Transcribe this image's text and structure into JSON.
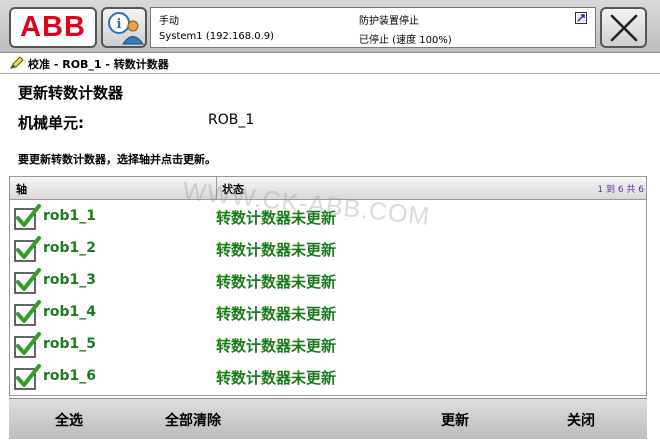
{
  "header": {
    "logo_text": "ABB",
    "mode": "手动",
    "system": "System1 (192.168.0.9)",
    "safety": "防护装置停止",
    "state": "已停止 (速度 100%)"
  },
  "title": {
    "text": "校准 - ROB_1 - 转数计数器"
  },
  "content": {
    "heading": "更新转数计数器",
    "mech_unit_label": "机械单元:",
    "mech_unit_value": "ROB_1",
    "instruction": "要更新转数计数器，选择轴并点击更新。"
  },
  "table": {
    "col_axis": "轴",
    "col_status": "状态",
    "count": "1 到 6 共 6",
    "rows": [
      {
        "name": "rob1_1",
        "status": "转数计数器未更新",
        "checked": true
      },
      {
        "name": "rob1_2",
        "status": "转数计数器未更新",
        "checked": true
      },
      {
        "name": "rob1_3",
        "status": "转数计数器未更新",
        "checked": true
      },
      {
        "name": "rob1_4",
        "status": "转数计数器未更新",
        "checked": true
      },
      {
        "name": "rob1_5",
        "status": "转数计数器未更新",
        "checked": true
      },
      {
        "name": "rob1_6",
        "status": "转数计数器未更新",
        "checked": true
      }
    ]
  },
  "watermark": "WWW.CK-ABB.COM",
  "footer": {
    "select_all": "全选",
    "clear_all": "全部清除",
    "update": "更新",
    "close": "关闭"
  },
  "colors": {
    "brand_red": "#e2001a",
    "status_green": "#1a7d1a",
    "check_green": "#2e9e2e"
  }
}
